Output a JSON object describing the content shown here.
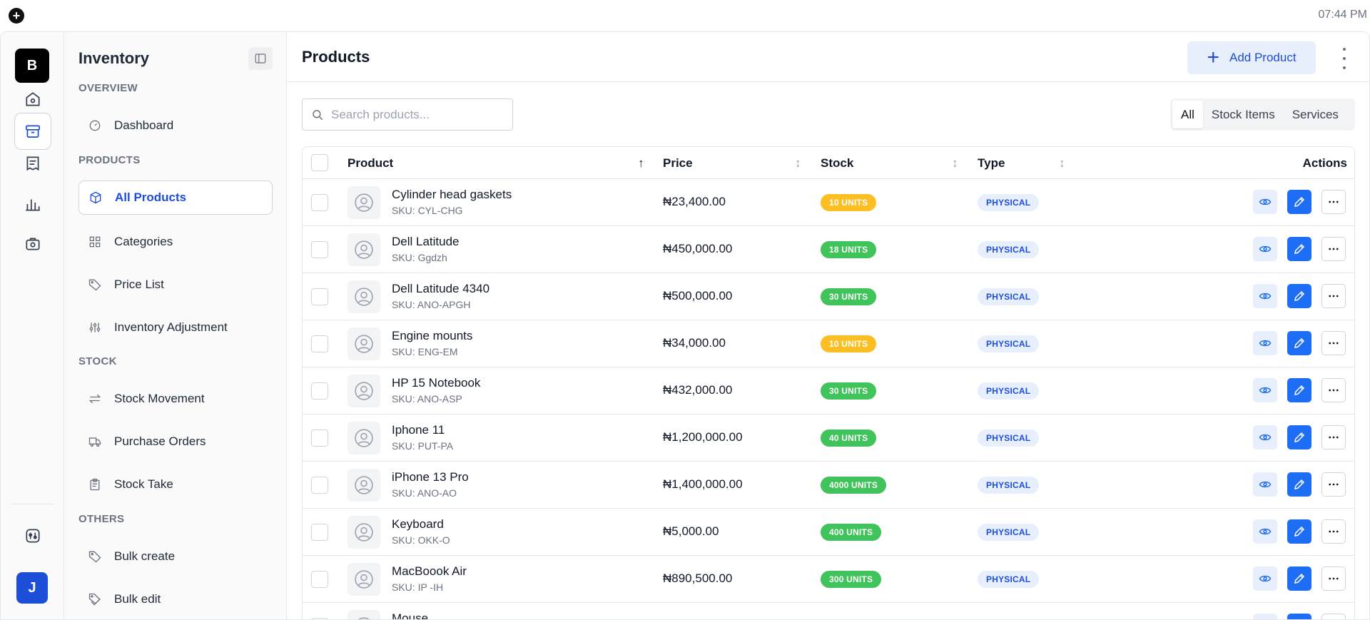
{
  "system": {
    "clock": "07:44 PM"
  },
  "rail": {
    "brand_letter": "B",
    "user_initial": "J"
  },
  "sidebar": {
    "title": "Inventory",
    "sections": [
      "OVERVIEW",
      "PRODUCTS",
      "STOCK",
      "OTHERS"
    ],
    "items": [
      {
        "label": "Dashboard",
        "icon": "gauge-icon"
      },
      {
        "label": "All Products",
        "icon": "box-icon",
        "active": true
      },
      {
        "label": "Categories",
        "icon": "grid-icon"
      },
      {
        "label": "Price List",
        "icon": "tag-icon"
      },
      {
        "label": "Inventory Adjustment",
        "icon": "sliders-icon"
      },
      {
        "label": "Stock Movement",
        "icon": "arrows-icon"
      },
      {
        "label": "Purchase Orders",
        "icon": "truck-icon"
      },
      {
        "label": "Stock Take",
        "icon": "clipboard-icon"
      },
      {
        "label": "Bulk create",
        "icon": "tag-icon"
      },
      {
        "label": "Bulk edit",
        "icon": "tags-icon"
      }
    ]
  },
  "header": {
    "title": "Products",
    "add_label": "Add Product"
  },
  "search": {
    "placeholder": "Search products..."
  },
  "filters": [
    "All",
    "Stock Items",
    "Services"
  ],
  "table": {
    "columns": {
      "product": "Product",
      "price": "Price",
      "stock": "Stock",
      "type": "Type",
      "actions": "Actions"
    },
    "rows": [
      {
        "name": "Cylinder head gaskets",
        "sku": "SKU: CYL-CHG",
        "price": "₦23,400.00",
        "stock": "10 UNITS",
        "stock_level": "low",
        "type": "PHYSICAL"
      },
      {
        "name": "Dell Latitude",
        "sku": "SKU: Ggdzh",
        "price": "₦450,000.00",
        "stock": "18 UNITS",
        "stock_level": "ok",
        "type": "PHYSICAL"
      },
      {
        "name": "Dell Latitude 4340",
        "sku": "SKU: ANO-APGH",
        "price": "₦500,000.00",
        "stock": "30 UNITS",
        "stock_level": "ok",
        "type": "PHYSICAL"
      },
      {
        "name": "Engine mounts",
        "sku": "SKU: ENG-EM",
        "price": "₦34,000.00",
        "stock": "10 UNITS",
        "stock_level": "low",
        "type": "PHYSICAL"
      },
      {
        "name": "HP 15 Notebook",
        "sku": "SKU: ANO-ASP",
        "price": "₦432,000.00",
        "stock": "30 UNITS",
        "stock_level": "ok",
        "type": "PHYSICAL"
      },
      {
        "name": "Iphone 11",
        "sku": "SKU: PUT-PA",
        "price": "₦1,200,000.00",
        "stock": "40 UNITS",
        "stock_level": "ok",
        "type": "PHYSICAL"
      },
      {
        "name": "iPhone 13 Pro",
        "sku": "SKU: ANO-AO",
        "price": "₦1,400,000.00",
        "stock": "4000 UNITS",
        "stock_level": "ok",
        "type": "PHYSICAL"
      },
      {
        "name": "Keyboard",
        "sku": "SKU: OKK-O",
        "price": "₦5,000.00",
        "stock": "400 UNITS",
        "stock_level": "ok",
        "type": "PHYSICAL"
      },
      {
        "name": "MacBoook Air",
        "sku": "SKU: IP -IH",
        "price": "₦890,500.00",
        "stock": "300 UNITS",
        "stock_level": "ok",
        "type": "PHYSICAL"
      },
      {
        "name": "Mouse",
        "sku": "",
        "price": "",
        "stock": "",
        "stock_level": "ok",
        "type": ""
      }
    ]
  },
  "colors": {
    "accent": "#1d6ef5",
    "low": "#fbbf24",
    "ok": "#3fc35a",
    "type_badge_bg": "#e8effc"
  }
}
